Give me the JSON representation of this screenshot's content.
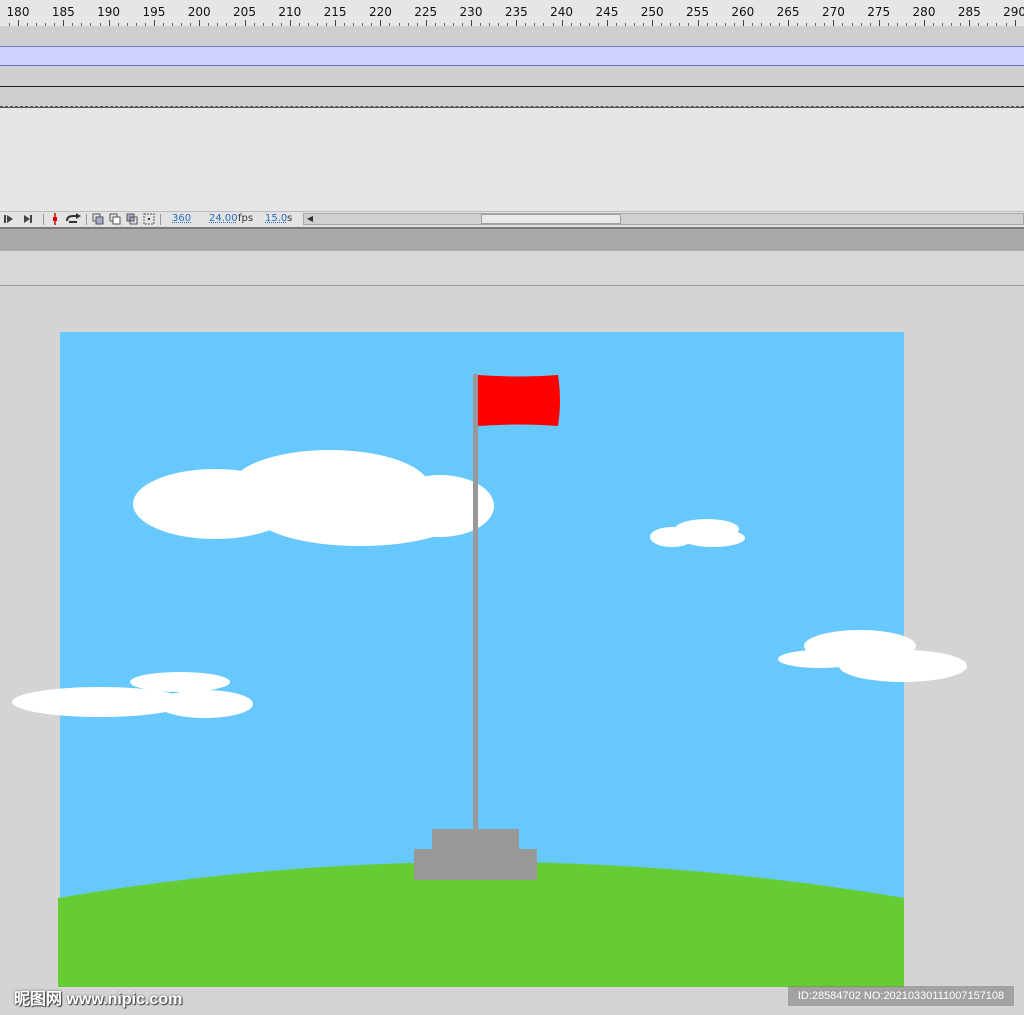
{
  "ruler": {
    "labels": [
      "180",
      "185",
      "190",
      "195",
      "200",
      "205",
      "210",
      "215",
      "220",
      "225",
      "230",
      "235",
      "240",
      "245",
      "250",
      "255",
      "260",
      "265",
      "270",
      "275",
      "280",
      "285",
      "290"
    ]
  },
  "timeline_toolbar": {
    "frame": "360",
    "fps_value": "24.00",
    "fps_unit": "fps",
    "time_value": "15.0",
    "time_unit": "s",
    "icons": [
      "step-forward-icon",
      "go-to-last-frame-icon",
      "playhead-marker-icon",
      "loop-icon",
      "center-frame-icon",
      "onion-skin-icon",
      "onion-skin-outlines-icon",
      "edit-multiple-frames-icon"
    ]
  },
  "stage": {
    "colors": {
      "sky": "#66c8fc",
      "grass": "#66cc33",
      "flag": "#ff0000",
      "pole": "#999999",
      "base": "#999999",
      "cloud": "#ffffff",
      "workspace": "#d4d4d4"
    }
  },
  "watermark": {
    "left": "昵图网 www.nipic.com",
    "right": "ID:28584702 NO:20210330111007157108"
  }
}
